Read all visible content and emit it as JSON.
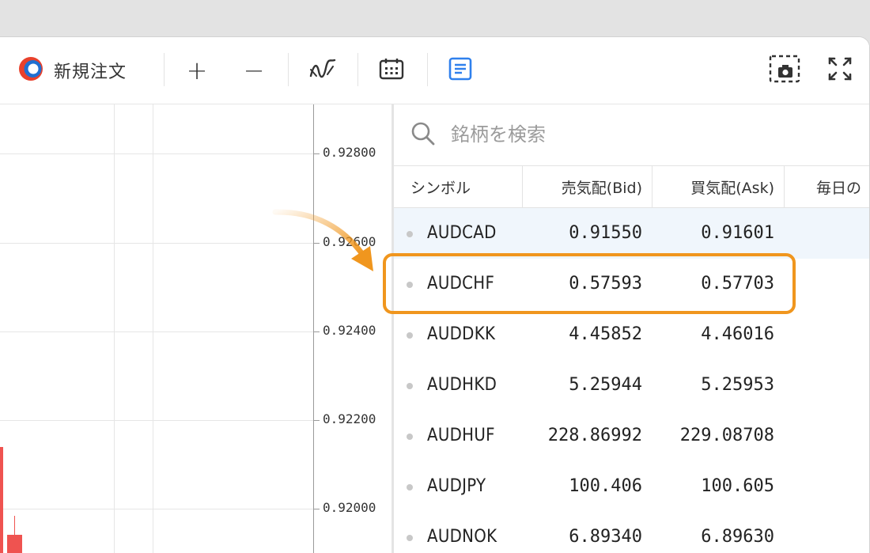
{
  "toolbar": {
    "new_order_label": "新規注文",
    "icons": [
      "logo-icon",
      "plus-icon",
      "minus-icon",
      "indicator-icon",
      "calendar-icon",
      "watchlist-icon",
      "screenshot-icon",
      "fullscreen-icon"
    ],
    "plus": "+",
    "minus": "−"
  },
  "price_axis": {
    "labels": [
      "0.92800",
      "0.92600",
      "0.92400",
      "0.92200",
      "0.92000"
    ]
  },
  "watchlist": {
    "search_placeholder": "銘柄を検索",
    "columns": {
      "symbol": "シンボル",
      "bid": "売気配(Bid)",
      "ask": "買気配(Ask)",
      "daily": "毎日の"
    },
    "rows": [
      {
        "symbol": "AUDCAD",
        "bid": "0.91550",
        "ask": "0.91601"
      },
      {
        "symbol": "AUDCHF",
        "bid": "0.57593",
        "ask": "0.57703"
      },
      {
        "symbol": "AUDDKK",
        "bid": "4.45852",
        "ask": "4.46016"
      },
      {
        "symbol": "AUDHKD",
        "bid": "5.25944",
        "ask": "5.25953"
      },
      {
        "symbol": "AUDHUF",
        "bid": "228.86992",
        "ask": "229.08708"
      },
      {
        "symbol": "AUDJPY",
        "bid": "100.406",
        "ask": "100.605"
      },
      {
        "symbol": "AUDNOK",
        "bid": "6.89340",
        "ask": "6.89630"
      }
    ],
    "selected_symbol": "AUDCAD",
    "highlighted_symbol": "AUDCHF"
  },
  "colors": {
    "highlight": "#f0961e",
    "candle_down": "#ef5350",
    "accent_blue": "#2f80ed",
    "selected_row": "#f0f6fc"
  }
}
